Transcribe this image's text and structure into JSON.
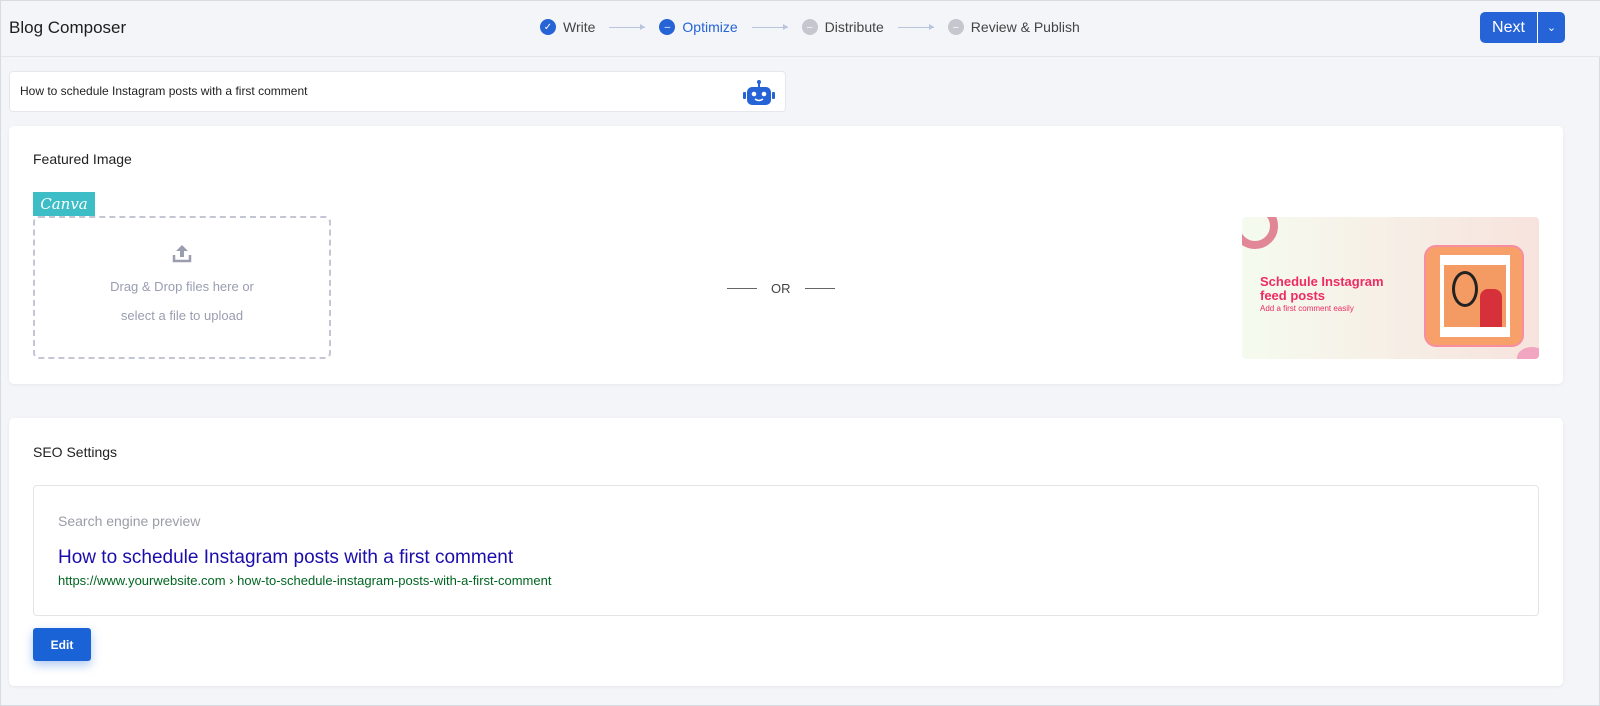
{
  "header": {
    "title": "Blog Composer",
    "steps": [
      {
        "label": "Write",
        "state": "done"
      },
      {
        "label": "Optimize",
        "state": "active"
      },
      {
        "label": "Distribute",
        "state": "pending"
      },
      {
        "label": "Review & Publish",
        "state": "pending"
      }
    ],
    "next_label": "Next"
  },
  "post_title": {
    "value": "How to schedule Instagram posts with a first comment",
    "icon": "robot-icon"
  },
  "featured": {
    "heading": "Featured Image",
    "canva_label": "Canva",
    "drop_line1": "Drag & Drop files here or",
    "drop_line2": "select a file to upload",
    "or": "OR",
    "thumb": {
      "title1": "Schedule Instagram",
      "title2": "feed posts",
      "subtitle": "Add a first comment easily"
    }
  },
  "seo": {
    "heading": "SEO Settings",
    "preview_label": "Search engine preview",
    "preview_title": "How to schedule Instagram posts with a first comment",
    "preview_url": "https://www.yourwebsite.com › how-to-schedule-instagram-posts-with-a-first-comment",
    "edit_label": "Edit"
  },
  "colors": {
    "accent": "#2563d6",
    "link": "#1a0dab",
    "url": "#006621",
    "canva": "#3dbdc6"
  }
}
